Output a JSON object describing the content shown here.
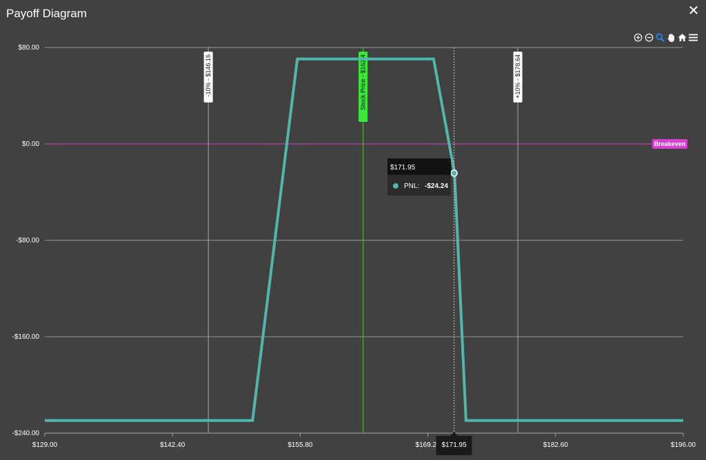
{
  "window": {
    "title": "Payoff Diagram",
    "close_glyph": "✕"
  },
  "toolbar": [
    {
      "name": "zoom-in-icon"
    },
    {
      "name": "zoom-out-icon"
    },
    {
      "name": "zoom-select-icon"
    },
    {
      "name": "pan-hand-icon"
    },
    {
      "name": "reset-home-icon"
    },
    {
      "name": "menu-icon"
    }
  ],
  "colors": {
    "background": "#414141",
    "payoff_line": "#4fb7ae",
    "grid": "#a8a8a8",
    "breakeven": "#d63fcf",
    "stock_price": "#5fbf3e",
    "stock_label_bg": "#39e83a",
    "tooltip_bg": "#2a2a2a",
    "tooltip_header_bg": "#121212"
  },
  "chart_data": {
    "type": "line",
    "xlim": [
      129.0,
      196.0
    ],
    "ylim": [
      -240,
      100
    ],
    "x_ticks": [
      "$129.00",
      "$142.40",
      "$155.80",
      "$169.20",
      "$182.60",
      "$196.00"
    ],
    "x_tick_values": [
      129.0,
      142.4,
      155.8,
      169.2,
      182.6,
      196.0
    ],
    "y_ticks": [
      "$80.00",
      "$0.00",
      "-$80.00",
      "-$160.00",
      "-$240.00"
    ],
    "y_tick_values": [
      80,
      0,
      -80,
      -160,
      -240
    ],
    "grid": true,
    "series": [
      {
        "x": [
          129.0,
          150.8,
          155.5,
          163.4,
          168.2,
          169.8,
          172.0,
          173.2,
          196.0
        ],
        "y": [
          -229.5,
          -229.5,
          70.5,
          70.5,
          70.5,
          70.5,
          -24.24,
          -229.5,
          -229.5
        ]
      }
    ],
    "reference_lines": [
      {
        "x": 146.16,
        "label": "-10% - $146.16",
        "kind": "range"
      },
      {
        "x": 162.4,
        "label": "Stock Price - $162.4",
        "kind": "stock"
      },
      {
        "x": 178.64,
        "label": "+10% - $178.64",
        "kind": "range"
      }
    ],
    "breakeven": {
      "y": 0,
      "label": "Breakeven"
    },
    "crosshair": {
      "x": 171.95,
      "y": -24.24,
      "x_label": "$171.95",
      "tooltip_title": "$171.95",
      "tooltip_series": "PNL:",
      "tooltip_value": "-$24.24"
    }
  }
}
